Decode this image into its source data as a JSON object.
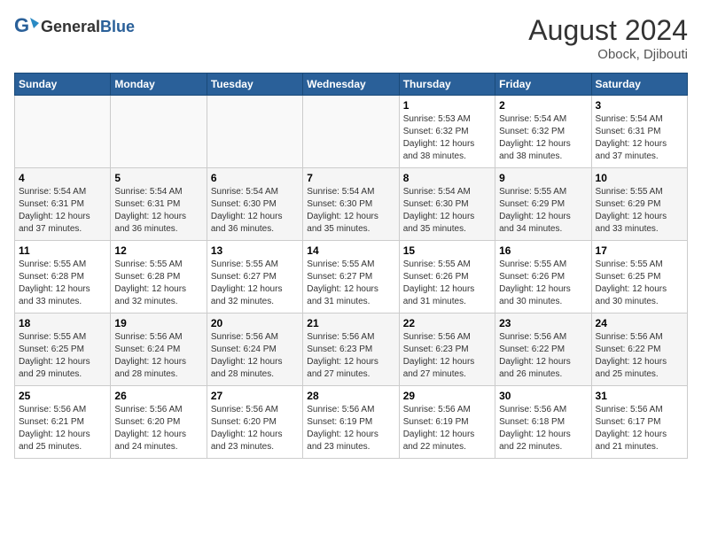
{
  "header": {
    "logo_general": "General",
    "logo_blue": "Blue",
    "month_year": "August 2024",
    "location": "Obock, Djibouti"
  },
  "days_of_week": [
    "Sunday",
    "Monday",
    "Tuesday",
    "Wednesday",
    "Thursday",
    "Friday",
    "Saturday"
  ],
  "weeks": [
    [
      {
        "day": "",
        "info": ""
      },
      {
        "day": "",
        "info": ""
      },
      {
        "day": "",
        "info": ""
      },
      {
        "day": "",
        "info": ""
      },
      {
        "day": "1",
        "info": "Sunrise: 5:53 AM\nSunset: 6:32 PM\nDaylight: 12 hours\nand 38 minutes."
      },
      {
        "day": "2",
        "info": "Sunrise: 5:54 AM\nSunset: 6:32 PM\nDaylight: 12 hours\nand 38 minutes."
      },
      {
        "day": "3",
        "info": "Sunrise: 5:54 AM\nSunset: 6:31 PM\nDaylight: 12 hours\nand 37 minutes."
      }
    ],
    [
      {
        "day": "4",
        "info": "Sunrise: 5:54 AM\nSunset: 6:31 PM\nDaylight: 12 hours\nand 37 minutes."
      },
      {
        "day": "5",
        "info": "Sunrise: 5:54 AM\nSunset: 6:31 PM\nDaylight: 12 hours\nand 36 minutes."
      },
      {
        "day": "6",
        "info": "Sunrise: 5:54 AM\nSunset: 6:30 PM\nDaylight: 12 hours\nand 36 minutes."
      },
      {
        "day": "7",
        "info": "Sunrise: 5:54 AM\nSunset: 6:30 PM\nDaylight: 12 hours\nand 35 minutes."
      },
      {
        "day": "8",
        "info": "Sunrise: 5:54 AM\nSunset: 6:30 PM\nDaylight: 12 hours\nand 35 minutes."
      },
      {
        "day": "9",
        "info": "Sunrise: 5:55 AM\nSunset: 6:29 PM\nDaylight: 12 hours\nand 34 minutes."
      },
      {
        "day": "10",
        "info": "Sunrise: 5:55 AM\nSunset: 6:29 PM\nDaylight: 12 hours\nand 33 minutes."
      }
    ],
    [
      {
        "day": "11",
        "info": "Sunrise: 5:55 AM\nSunset: 6:28 PM\nDaylight: 12 hours\nand 33 minutes."
      },
      {
        "day": "12",
        "info": "Sunrise: 5:55 AM\nSunset: 6:28 PM\nDaylight: 12 hours\nand 32 minutes."
      },
      {
        "day": "13",
        "info": "Sunrise: 5:55 AM\nSunset: 6:27 PM\nDaylight: 12 hours\nand 32 minutes."
      },
      {
        "day": "14",
        "info": "Sunrise: 5:55 AM\nSunset: 6:27 PM\nDaylight: 12 hours\nand 31 minutes."
      },
      {
        "day": "15",
        "info": "Sunrise: 5:55 AM\nSunset: 6:26 PM\nDaylight: 12 hours\nand 31 minutes."
      },
      {
        "day": "16",
        "info": "Sunrise: 5:55 AM\nSunset: 6:26 PM\nDaylight: 12 hours\nand 30 minutes."
      },
      {
        "day": "17",
        "info": "Sunrise: 5:55 AM\nSunset: 6:25 PM\nDaylight: 12 hours\nand 30 minutes."
      }
    ],
    [
      {
        "day": "18",
        "info": "Sunrise: 5:55 AM\nSunset: 6:25 PM\nDaylight: 12 hours\nand 29 minutes."
      },
      {
        "day": "19",
        "info": "Sunrise: 5:56 AM\nSunset: 6:24 PM\nDaylight: 12 hours\nand 28 minutes."
      },
      {
        "day": "20",
        "info": "Sunrise: 5:56 AM\nSunset: 6:24 PM\nDaylight: 12 hours\nand 28 minutes."
      },
      {
        "day": "21",
        "info": "Sunrise: 5:56 AM\nSunset: 6:23 PM\nDaylight: 12 hours\nand 27 minutes."
      },
      {
        "day": "22",
        "info": "Sunrise: 5:56 AM\nSunset: 6:23 PM\nDaylight: 12 hours\nand 27 minutes."
      },
      {
        "day": "23",
        "info": "Sunrise: 5:56 AM\nSunset: 6:22 PM\nDaylight: 12 hours\nand 26 minutes."
      },
      {
        "day": "24",
        "info": "Sunrise: 5:56 AM\nSunset: 6:22 PM\nDaylight: 12 hours\nand 25 minutes."
      }
    ],
    [
      {
        "day": "25",
        "info": "Sunrise: 5:56 AM\nSunset: 6:21 PM\nDaylight: 12 hours\nand 25 minutes."
      },
      {
        "day": "26",
        "info": "Sunrise: 5:56 AM\nSunset: 6:20 PM\nDaylight: 12 hours\nand 24 minutes."
      },
      {
        "day": "27",
        "info": "Sunrise: 5:56 AM\nSunset: 6:20 PM\nDaylight: 12 hours\nand 23 minutes."
      },
      {
        "day": "28",
        "info": "Sunrise: 5:56 AM\nSunset: 6:19 PM\nDaylight: 12 hours\nand 23 minutes."
      },
      {
        "day": "29",
        "info": "Sunrise: 5:56 AM\nSunset: 6:19 PM\nDaylight: 12 hours\nand 22 minutes."
      },
      {
        "day": "30",
        "info": "Sunrise: 5:56 AM\nSunset: 6:18 PM\nDaylight: 12 hours\nand 22 minutes."
      },
      {
        "day": "31",
        "info": "Sunrise: 5:56 AM\nSunset: 6:17 PM\nDaylight: 12 hours\nand 21 minutes."
      }
    ]
  ]
}
